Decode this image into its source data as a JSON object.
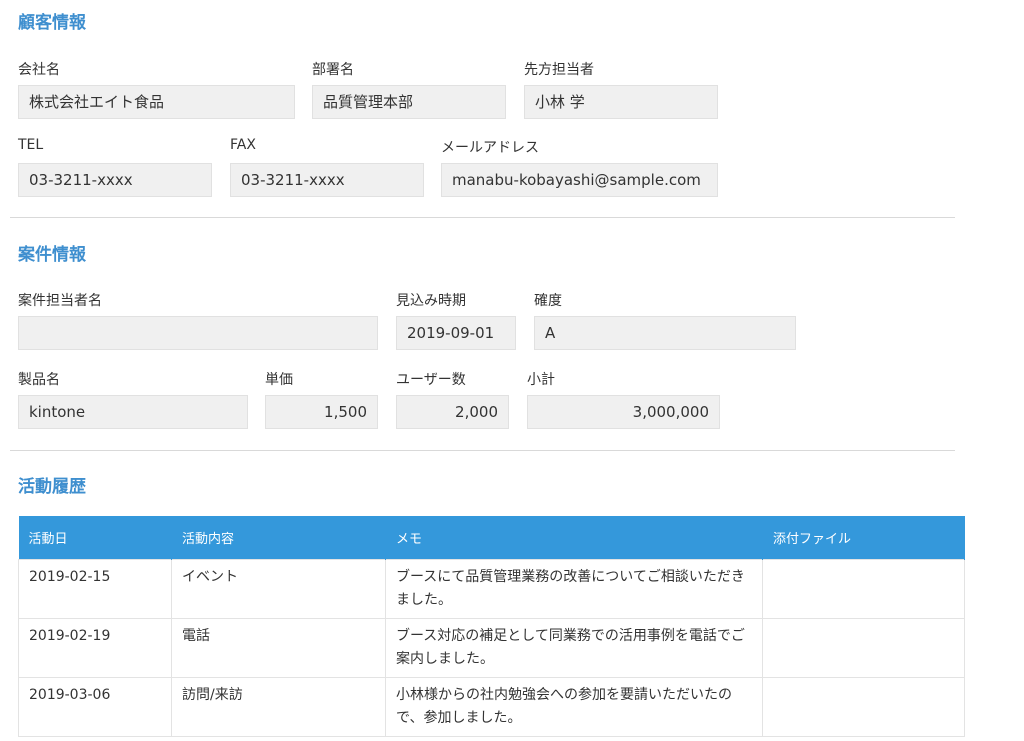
{
  "customer_section": {
    "title": "顧客情報",
    "company_label": "会社名",
    "company_value": "株式会社エイト食品",
    "department_label": "部署名",
    "department_value": "品質管理本部",
    "contact_label": "先方担当者",
    "contact_value": "小林 学",
    "tel_label": "TEL",
    "tel_value": "03-3211-xxxx",
    "fax_label": "FAX",
    "fax_value": "03-3211-xxxx",
    "email_label": "メールアドレス",
    "email_value": "manabu-kobayashi@sample.com"
  },
  "project_section": {
    "title": "案件情報",
    "owner_label": "案件担当者名",
    "owner_value": "",
    "forecast_label": "見込み時期",
    "forecast_value": "2019-09-01",
    "certainty_label": "確度",
    "certainty_value": "A",
    "product_label": "製品名",
    "product_value": "kintone",
    "unit_price_label": "単価",
    "unit_price_value": "1,500",
    "users_label": "ユーザー数",
    "users_value": "2,000",
    "subtotal_label": "小計",
    "subtotal_value": "3,000,000"
  },
  "history_section": {
    "title": "活動履歴",
    "columns": [
      "活動日",
      "活動内容",
      "メモ",
      "添付ファイル"
    ],
    "rows": [
      {
        "date": "2019-02-15",
        "type": "イベント",
        "memo": "ブースにて品質管理業務の改善についてご相談いただきました。",
        "attachment": ""
      },
      {
        "date": "2019-02-19",
        "type": "電話",
        "memo": "ブース対応の補足として同業務での活用事例を電話でご案内しました。",
        "attachment": ""
      },
      {
        "date": "2019-03-06",
        "type": "訪問/来訪",
        "memo": "小林様からの社内勉強会への参加を要請いただいたので、参加しました。",
        "attachment": ""
      }
    ]
  },
  "colors": {
    "accent": "#3f8fcf",
    "table_header": "#3498db",
    "field_bg": "#f0f0f0"
  }
}
